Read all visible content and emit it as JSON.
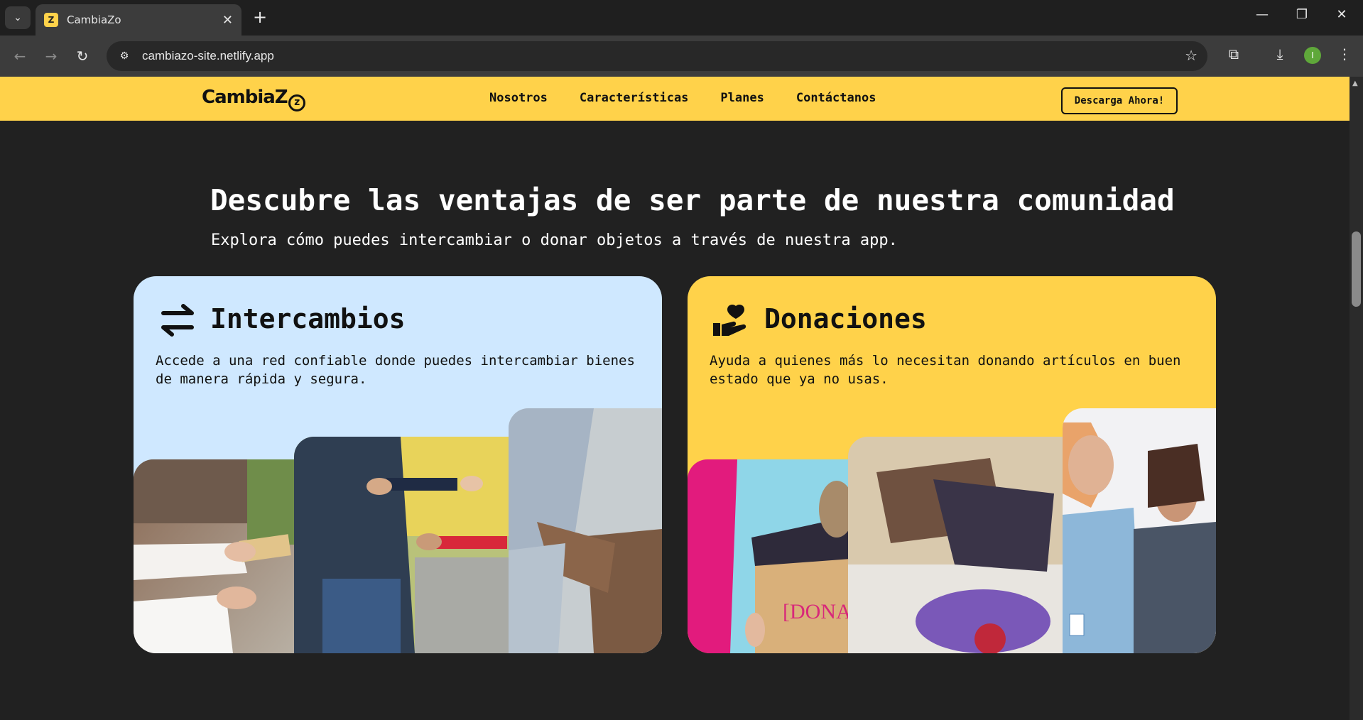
{
  "browser": {
    "tab_title": "CambiaZo",
    "url": "cambiazo-site.netlify.app",
    "profile_initial": "I"
  },
  "site": {
    "logo_text": "CambiaZ",
    "nav": [
      "Nosotros",
      "Características",
      "Planes",
      "Contáctanos"
    ],
    "cta": "Descarga Ahora!",
    "brand_yellow": "#ffd24a",
    "light_blue": "#cfe8ff"
  },
  "section": {
    "title": "Descubre las ventajas de ser parte de nuestra comunidad",
    "subtitle": "Explora cómo puedes intercambiar o donar objetos a través de nuestra app."
  },
  "cards": [
    {
      "icon": "swap-arrows-icon",
      "title": "Intercambios",
      "text": "Accede a una red confiable donde puedes intercambiar bienes de manera rápida y segura."
    },
    {
      "icon": "donate-heart-hand-icon",
      "title": "Donaciones",
      "text": "Ayuda a quienes más lo necesitan donando artículos en buen estado que ya no usas.",
      "photo_text": "[DONA"
    }
  ]
}
